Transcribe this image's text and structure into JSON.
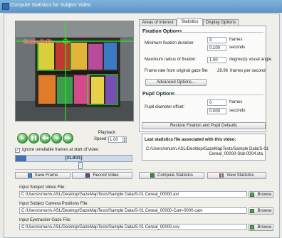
{
  "window": {
    "title": "Compute Statistics for Subject Video"
  },
  "video": {
    "overlay_text": "Cocoa Puffs"
  },
  "playback": {
    "label_line1": "Playback",
    "label_line2": "Speed:",
    "speed_value": "1.00",
    "buttons": [
      "play",
      "stop",
      "rewind",
      "step-back",
      "step-forward"
    ]
  },
  "ignore_frames": {
    "label": "Ignore unreliable frames at start of video",
    "checked": true
  },
  "timebar": {
    "readout": "[31.9/31]",
    "progress_fraction": 0.09
  },
  "scrubber": {
    "position_fraction": 0.56
  },
  "actions": {
    "save_frame": "Save Frame",
    "record_video": "Record Video",
    "compute_statistics": "Compute Statistics",
    "view_statistics": "View Statistics"
  },
  "tabs": [
    "Areas of Interest",
    "Statistics",
    "Display Options"
  ],
  "active_tab": "Statistics",
  "fixation": {
    "title": "Fixation Options",
    "min_duration_label": "Minimum fixation duration:",
    "min_frames_value": "3",
    "frames_unit": "frames",
    "min_seconds_value": "0.100",
    "seconds_unit": "seconds",
    "max_radius_label": "Maximum radius of fixation:",
    "max_radius_value": "1.00",
    "max_radius_unit": "degree(s) visual angle",
    "frame_rate_label": "Frame rate from original gaze file:",
    "frame_rate_value": "29.96",
    "frame_rate_unit": "frames per second",
    "advanced_button": "Advanced Options..."
  },
  "pupil": {
    "title": "Pupil Options",
    "offset_label": "Pupil diameter offset:",
    "frames_value": "0",
    "frames_unit": "frames",
    "seconds_value": "0.000",
    "seconds_unit": "seconds"
  },
  "restore_button": "Restore Fixation and Pupil Defaults",
  "stats_file": {
    "label": "Last statistics file associated with this video:",
    "path_line1": "C:/Users/smunn.ASL/Desktop/GazeMapTests/Sample Data/S-01",
    "path_line2": "Cereal_00000-Stat-0004.sta"
  },
  "inputs": {
    "video_label": "Input Subject Video File:",
    "video_path": "C:/Users/smunn.ASL/Desktop/GazeMapTests/Sample Data/S-01 Cereal_00000.avi",
    "camera_label": "Input Subject Camera Positions File:",
    "camera_path": "C:/Users/smunn.ASL/Desktop/GazeMapTests/Sample Data/S-01 Cereal_00000-Cam-0000.cam",
    "eyetracker_label": "Input Eyetracker Gaze File:",
    "eyetracker_path": "C:/Users/smunn.ASL/Desktop/GazeMapTests/Sample Data/S-01 Cereal_00000.csv",
    "browse_label": "Browse"
  },
  "colors": {
    "accent": "#3f73b6",
    "play_green": "#39a53d",
    "gaze_green": "#22ee22",
    "title_bar": "#6fa3d2"
  }
}
